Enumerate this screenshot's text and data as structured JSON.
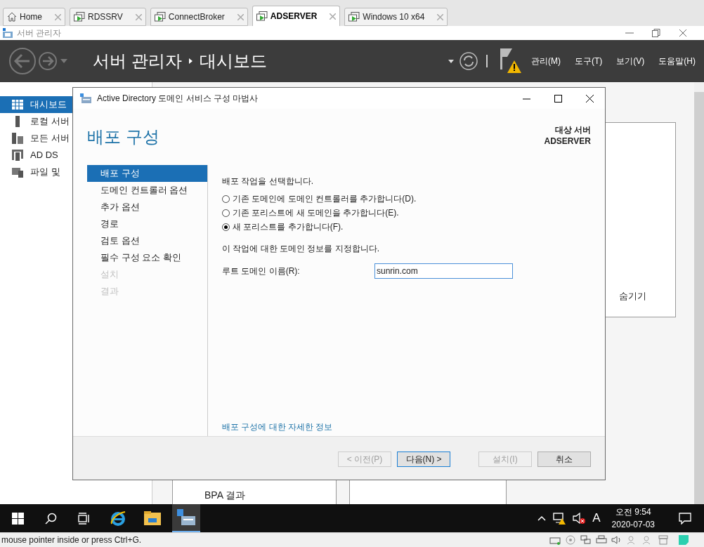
{
  "vm_tabs": [
    {
      "label": "Home",
      "kind": "home",
      "selected": false
    },
    {
      "label": "RDSSRV",
      "kind": "vm",
      "selected": false
    },
    {
      "label": "ConnectBroker",
      "kind": "vm",
      "selected": false
    },
    {
      "label": "ADSERVER",
      "kind": "vm",
      "selected": true
    },
    {
      "label": "Windows 10 x64",
      "kind": "vm",
      "selected": false
    }
  ],
  "window": {
    "title": "서버 관리자"
  },
  "header": {
    "breadcrumb": [
      "서버 관리자",
      "대시보드"
    ],
    "menus": [
      "관리(M)",
      "도구(T)",
      "보기(V)",
      "도움말(H)"
    ]
  },
  "sidebar": {
    "items": [
      {
        "label": "대시보드",
        "kind": "grid",
        "selected": true
      },
      {
        "label": "로컬 서버",
        "kind": "server",
        "selected": false
      },
      {
        "label": "모든 서버",
        "kind": "servers",
        "selected": false
      },
      {
        "label": "AD DS",
        "kind": "adds",
        "selected": false
      },
      {
        "label": "파일 및",
        "kind": "files",
        "selected": false
      }
    ]
  },
  "background": {
    "hide_link": "숨기기",
    "tile_text": "BPA 결과"
  },
  "dialog": {
    "title": "Active Directory 도메인 서비스 구성 마법사",
    "heading": "배포 구성",
    "target_label": "대상 서버",
    "target_server": "ADSERVER",
    "steps": [
      {
        "label": "배포 구성",
        "selected": true,
        "disabled": false
      },
      {
        "label": "도메인 컨트롤러 옵션",
        "selected": false,
        "disabled": false
      },
      {
        "label": "추가 옵션",
        "selected": false,
        "disabled": false
      },
      {
        "label": "경로",
        "selected": false,
        "disabled": false
      },
      {
        "label": "검토 옵션",
        "selected": false,
        "disabled": false
      },
      {
        "label": "필수 구성 요소 확인",
        "selected": false,
        "disabled": false
      },
      {
        "label": "설치",
        "selected": false,
        "disabled": true
      },
      {
        "label": "결과",
        "selected": false,
        "disabled": true
      }
    ],
    "prompt": "배포 작업을 선택합니다.",
    "options": [
      {
        "label": "기존 도메인에 도메인 컨트롤러를 추가합니다(D).",
        "selected": false
      },
      {
        "label": "기존 포리스트에 새 도메인을 추가합니다(E).",
        "selected": false
      },
      {
        "label": "새 포리스트를 추가합니다(F).",
        "selected": true
      }
    ],
    "info": "이 작업에 대한 도메인 정보를 지정합니다.",
    "field": {
      "label": "루트 도메인 이름(R):",
      "value": "sunrin.com"
    },
    "more_link": "배포 구성에 대한 자세한 정보",
    "buttons": [
      {
        "label": "< 이전(P)",
        "disabled": true,
        "default": false
      },
      {
        "label": "다음(N) >",
        "disabled": false,
        "default": true
      },
      {
        "label": "설치(I)",
        "disabled": true,
        "default": false
      },
      {
        "label": "취소",
        "disabled": false,
        "default": false
      }
    ]
  },
  "taskbar": {
    "ime": "A",
    "time": "오전 9:54",
    "date": "2020-07-03"
  },
  "status_bar": {
    "text": "mouse pointer inside or press Ctrl+G."
  }
}
